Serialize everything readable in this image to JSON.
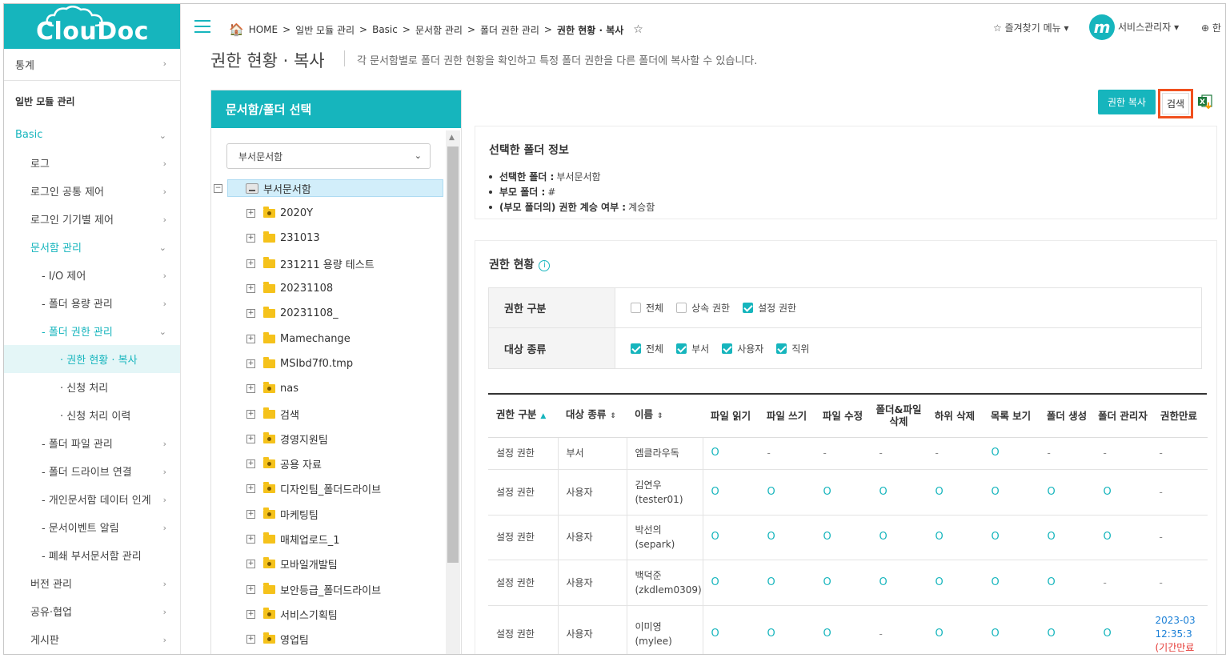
{
  "app": {
    "logo": "ClouDoc"
  },
  "topbar": {
    "breadcrumbs": [
      "HOME",
      "일반 모듈 관리",
      "Basic",
      "문서함 관리",
      "폴더 권한 관리",
      "권한 현황 · 복사"
    ],
    "separator": ">",
    "favorites_label": "즐겨찾기 메뉴",
    "user_initial": "m",
    "user_label": "서비스관리자",
    "lang_label": "한"
  },
  "sidebar": {
    "items": [
      {
        "label": "통계",
        "level": 0,
        "chev": "›"
      },
      {
        "label": "일반 모듈 관리",
        "level": 0,
        "group": true
      },
      {
        "label": "Basic",
        "level": 0,
        "chev": "⌄",
        "active": true
      },
      {
        "label": "로그",
        "level": 1,
        "chev": "›"
      },
      {
        "label": "로그인 공통 제어",
        "level": 1,
        "chev": "›"
      },
      {
        "label": "로그인 기기별 제어",
        "level": 1,
        "chev": "›"
      },
      {
        "label": "문서함 관리",
        "level": 1,
        "chev": "⌄",
        "active": true
      },
      {
        "label": "- I/O 제어",
        "level": 2,
        "chev": "›"
      },
      {
        "label": "- 폴더 용량 관리",
        "level": 2,
        "chev": "›"
      },
      {
        "label": "- 폴더 권한 관리",
        "level": 2,
        "chev": "⌄",
        "active": true
      },
      {
        "label": "· 권한 현황 · 복사",
        "level": 3,
        "selected": true
      },
      {
        "label": "· 신청 처리",
        "level": 3
      },
      {
        "label": "· 신청 처리 이력",
        "level": 3
      },
      {
        "label": "- 폴더 파일 관리",
        "level": 2,
        "chev": "›"
      },
      {
        "label": "- 폴더 드라이브 연결",
        "level": 2,
        "chev": "›"
      },
      {
        "label": "- 개인문서함 데이터 인계",
        "level": 2,
        "chev": "›"
      },
      {
        "label": "- 문서이벤트 알림",
        "level": 2,
        "chev": "›"
      },
      {
        "label": "- 폐쇄 부서문서함 관리",
        "level": 2
      },
      {
        "label": "버전 관리",
        "level": 1,
        "chev": "›"
      },
      {
        "label": "공유·협업",
        "level": 1,
        "chev": "›"
      },
      {
        "label": "게시판",
        "level": 1,
        "chev": "›"
      }
    ]
  },
  "page": {
    "title": "권한 현황 · 복사",
    "description": "각 문서함별로 폴더 권한 현황을 확인하고 특정 폴더 권한을 다른 폴더에 복사할 수 있습니다."
  },
  "left_panel": {
    "title": "문서함/폴더 선택",
    "select_value": "부서문서함",
    "tree_root": "부서문서함",
    "tree_children": [
      {
        "label": "2020Y",
        "shared": true
      },
      {
        "label": "231013",
        "shared": false
      },
      {
        "label": "231211 용량 테스트",
        "shared": false
      },
      {
        "label": "20231108",
        "shared": false
      },
      {
        "label": "20231108_",
        "shared": false
      },
      {
        "label": "Mamechange",
        "shared": false
      },
      {
        "label": "MSIbd7f0.tmp",
        "shared": false
      },
      {
        "label": "nas",
        "shared": true
      },
      {
        "label": "검색",
        "shared": false
      },
      {
        "label": "경영지원팀",
        "shared": true
      },
      {
        "label": "공용 자료",
        "shared": true
      },
      {
        "label": "디자인팀_폴더드라이브",
        "shared": true
      },
      {
        "label": "마케팅팀",
        "shared": true
      },
      {
        "label": "매체업로드_1",
        "shared": false
      },
      {
        "label": "모바일개발팀",
        "shared": true
      },
      {
        "label": "보안등급_폴더드라이브",
        "shared": false
      },
      {
        "label": "서비스기획팀",
        "shared": true
      },
      {
        "label": "영업팀",
        "shared": true
      }
    ]
  },
  "actions": {
    "copy_label": "권한 복사",
    "search_label": "검색"
  },
  "folder_info": {
    "title": "선택한 폴더 정보",
    "items": [
      {
        "key": "선택한 폴더 :",
        "value": "부서문서함"
      },
      {
        "key": "부모 폴더 :",
        "value": "#"
      },
      {
        "key": "(부모 폴더의) 권한 계승 여부 :",
        "value": "계승함"
      }
    ]
  },
  "permission": {
    "title": "권한 현황",
    "filters": [
      {
        "label": "권한 구분",
        "options": [
          {
            "label": "전체",
            "checked": false
          },
          {
            "label": "상속 권한",
            "checked": false
          },
          {
            "label": "설정 권한",
            "checked": true
          }
        ]
      },
      {
        "label": "대상 종류",
        "options": [
          {
            "label": "전체",
            "checked": true
          },
          {
            "label": "부서",
            "checked": true
          },
          {
            "label": "사용자",
            "checked": true
          },
          {
            "label": "직위",
            "checked": true
          }
        ]
      }
    ],
    "columns": [
      "권한 구분",
      "대상 종류",
      "이름",
      "파일 읽기",
      "파일 쓰기",
      "파일 수정",
      "폴더&파일 삭제",
      "하위 삭제",
      "목록 보기",
      "폴더 생성",
      "폴더 관리자",
      "권한만료"
    ],
    "rows": [
      {
        "type": "설정 권한",
        "target": "부서",
        "name": "엠클라우독",
        "id": "",
        "perms": [
          "O",
          "-",
          "-",
          "-",
          "-",
          "O",
          "-",
          "-"
        ],
        "expire": "-",
        "expire_note": ""
      },
      {
        "type": "설정 권한",
        "target": "사용자",
        "name": "김연우",
        "id": "(tester01)",
        "perms": [
          "O",
          "O",
          "O",
          "O",
          "O",
          "O",
          "O",
          "O"
        ],
        "expire": "-",
        "expire_note": ""
      },
      {
        "type": "설정 권한",
        "target": "사용자",
        "name": "박선의",
        "id": "(separk)",
        "perms": [
          "O",
          "O",
          "O",
          "O",
          "O",
          "O",
          "O",
          "O"
        ],
        "expire": "-",
        "expire_note": ""
      },
      {
        "type": "설정 권한",
        "target": "사용자",
        "name": "백덕준",
        "id": "(zkdlem0309)",
        "perms": [
          "O",
          "O",
          "O",
          "O",
          "O",
          "O",
          "O",
          "-"
        ],
        "expire": "-",
        "expire_note": ""
      },
      {
        "type": "설정 권한",
        "target": "사용자",
        "name": "이미영",
        "id": "(mylee)",
        "perms": [
          "O",
          "O",
          "O",
          "-",
          "O",
          "O",
          "O",
          "O"
        ],
        "expire": "2023-03",
        "expire_time": "12:35:3",
        "expire_note": "(기간만료"
      }
    ]
  },
  "colors": {
    "accent": "#16b5bd",
    "highlight": "#f0501e",
    "link": "#1a7fd6",
    "expired": "#e53935"
  }
}
